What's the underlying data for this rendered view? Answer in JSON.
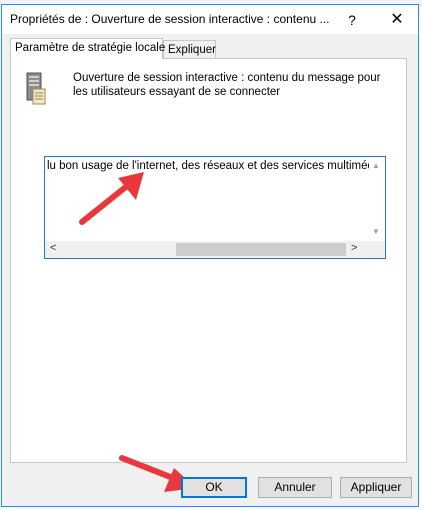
{
  "window": {
    "title": "Propriétés de : Ouverture de session interactive : contenu ...",
    "help_label": "?",
    "close_label": "✕"
  },
  "tabs": [
    {
      "label": "Paramètre de stratégie locale",
      "active": true
    },
    {
      "label": "Expliquer",
      "active": false
    }
  ],
  "policy": {
    "title": "Ouverture de session interactive : contenu du message pour les utilisateurs essayant de se connecter",
    "icon": "server-policy-icon"
  },
  "message_box": {
    "value": "lu bon usage de l'internet, des réseaux et des services multimédias."
  },
  "scrollbar": {
    "left_arrow": "<",
    "right_arrow": ">",
    "up_arrow": "▲",
    "down_arrow": "▼"
  },
  "buttons": {
    "ok": "OK",
    "cancel": "Annuler",
    "apply": "Appliquer"
  },
  "colors": {
    "accent": "#0078d7",
    "annotation_arrow": "#e8383d"
  }
}
